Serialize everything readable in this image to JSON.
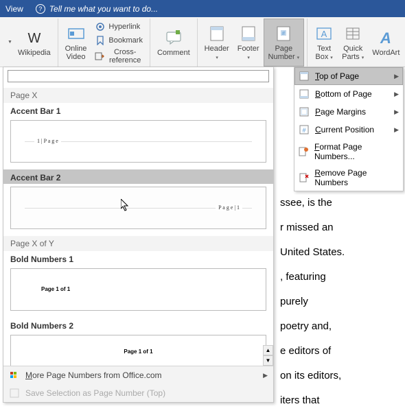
{
  "titlebar": {
    "view": "View",
    "tellme": "Tell me what you want to do..."
  },
  "ribbon": {
    "wikipedia": "Wikipedia",
    "online_video": "Online\nVideo",
    "hyperlink": "Hyperlink",
    "bookmark": "Bookmark",
    "crossref": "Cross-reference",
    "comment": "Comment",
    "header": "Header",
    "footer": "Footer",
    "page_number": "Page\nNumber",
    "text_box": "Text\nBox",
    "quick_parts": "Quick\nParts",
    "wordart": "WordArt"
  },
  "submenu": {
    "top": "Top of Page",
    "bottom": "Bottom of Page",
    "margins": "Page Margins",
    "current": "Current Position",
    "format": "Format Page Numbers...",
    "remove": "Remove Page Numbers"
  },
  "gallery": {
    "cat_pagex": "Page X",
    "accent1": "Accent Bar 1",
    "accent1_preview": "1 | P a g e",
    "accent2": "Accent Bar 2",
    "accent2_preview": "P a g e  | 1",
    "cat_pagexofy": "Page X of Y",
    "bold1": "Bold Numbers 1",
    "bold1_preview": "Page 1 of 1",
    "bold2": "Bold Numbers 2",
    "bold2_preview": "Page 1 of 1",
    "more": "More Page Numbers from Office.com",
    "save": "Save Selection as Page Number (Top)"
  },
  "doc_lines": [
    "ssee, is the",
    "r missed an",
    "United States.",
    ", featuring",
    "purely",
    "poetry and,",
    "e editors of",
    "on its editors,",
    "iters that"
  ]
}
